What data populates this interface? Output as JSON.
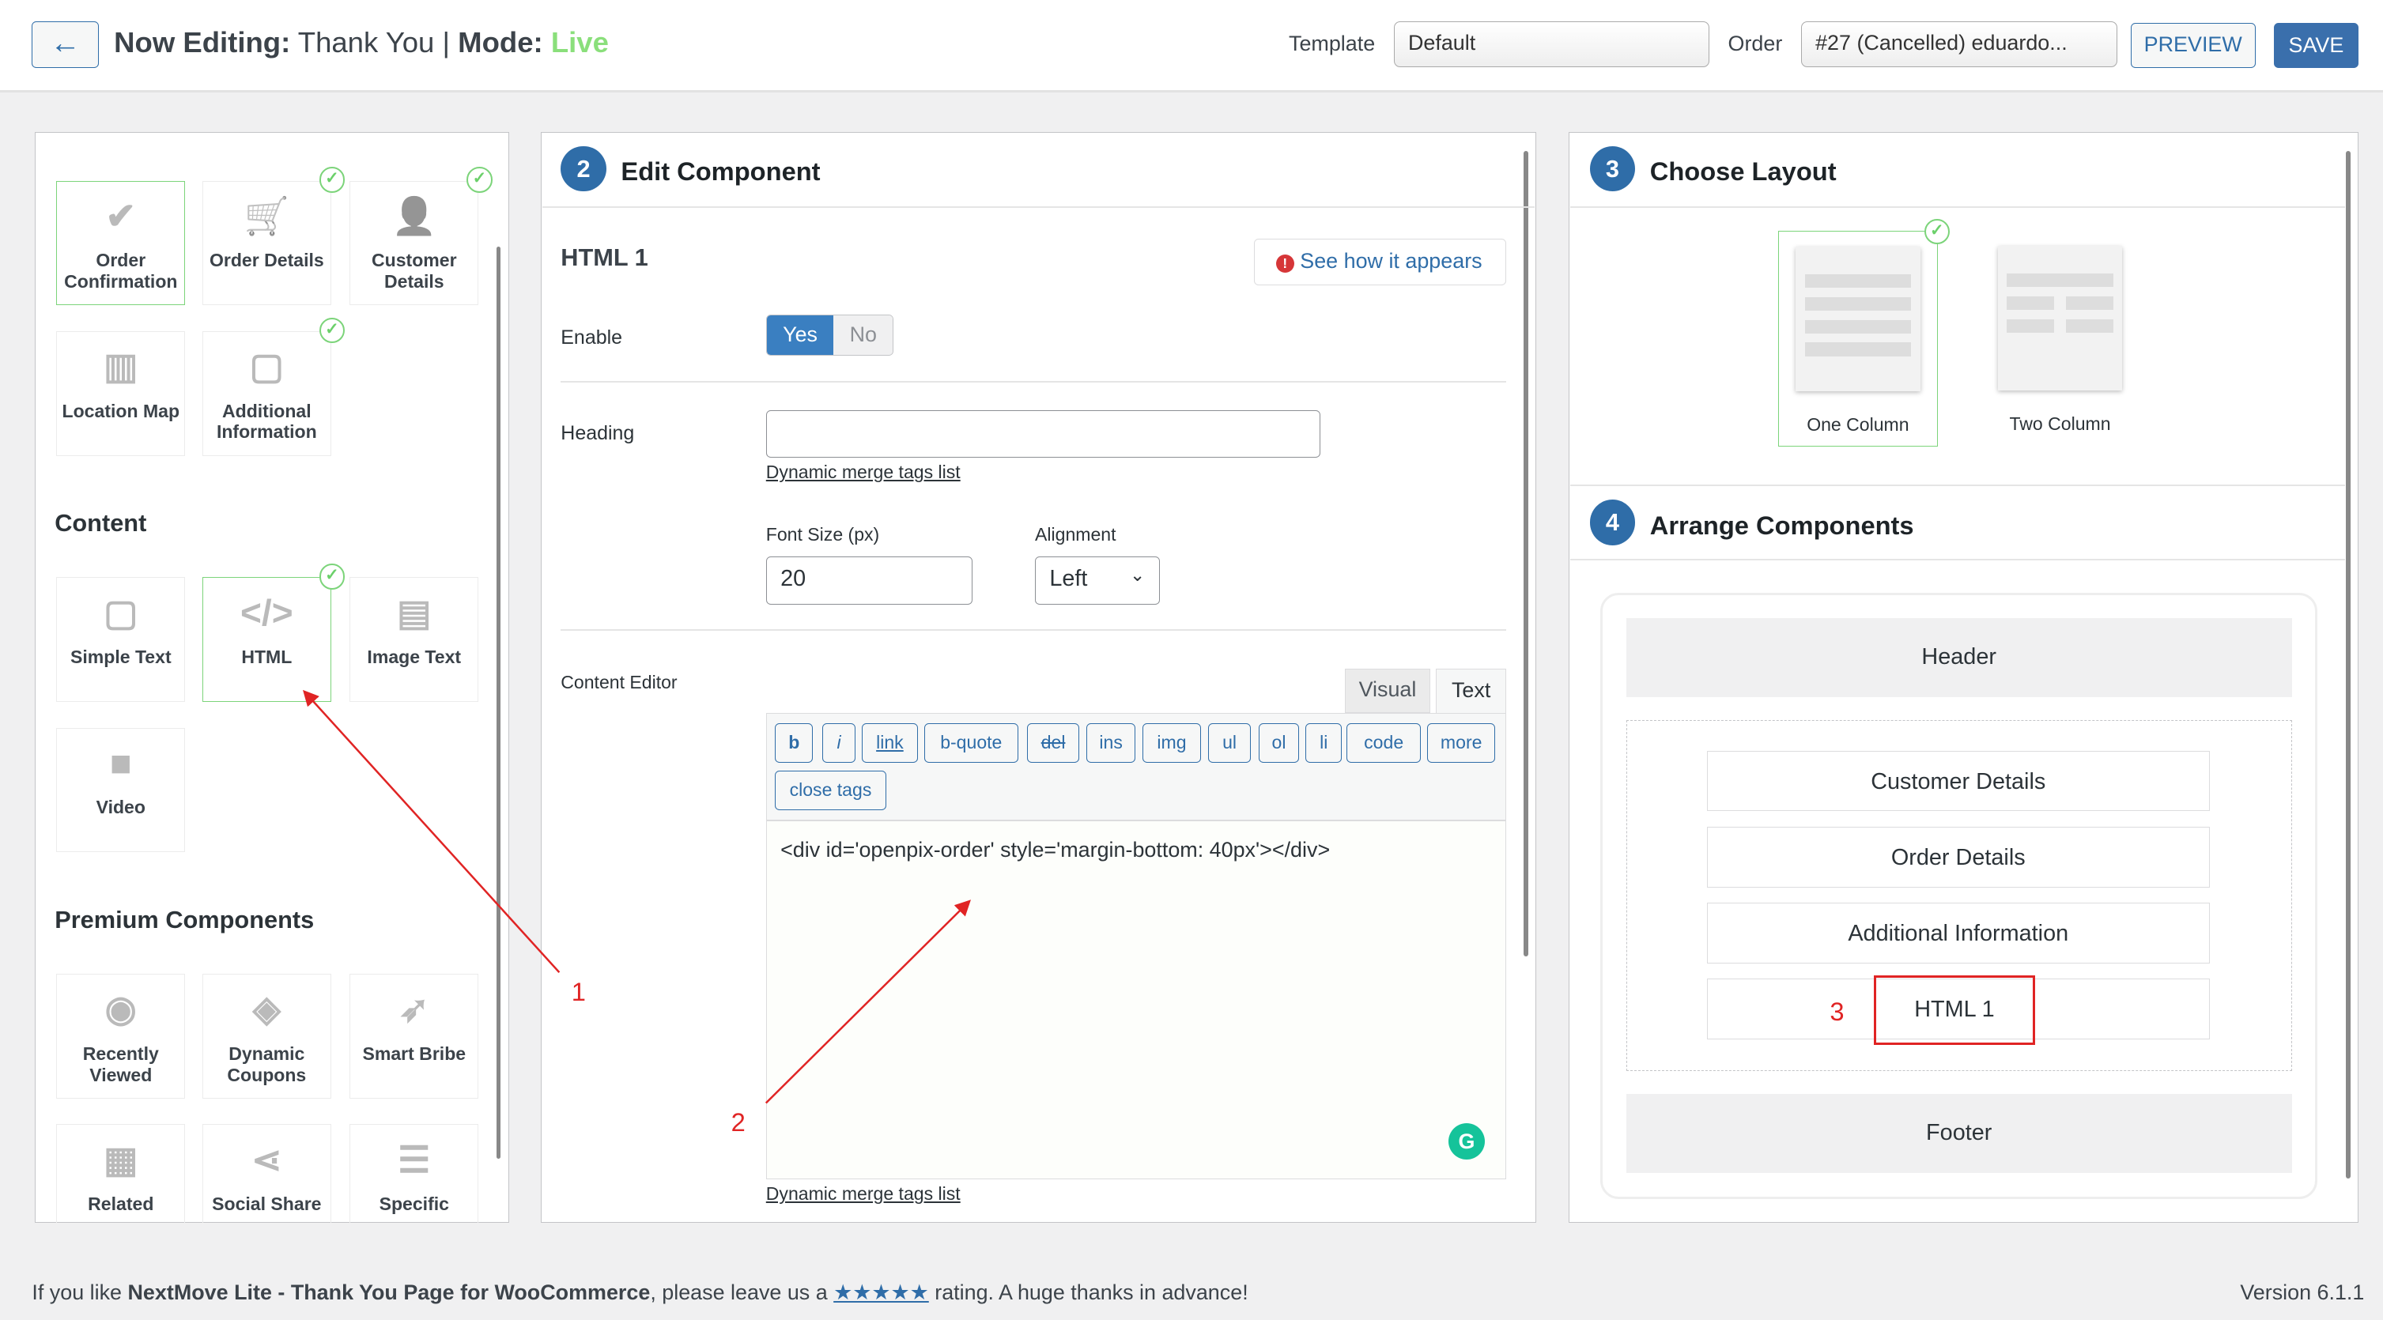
{
  "header": {
    "back_icon": "arrow-left-icon",
    "now_editing_label": "Now Editing:",
    "page_name": "Thank You",
    "separator": "|",
    "mode_label": "Mode:",
    "mode_value": "Live",
    "mode_color": "#8adf7b",
    "template_label": "Template",
    "template_value": "Default",
    "order_label": "Order",
    "order_value": "#27 (Cancelled) eduardo...",
    "preview_label": "PREVIEW",
    "save_label": "SAVE"
  },
  "components": {
    "basic": [
      {
        "label": "Order Confirmation",
        "icon": "check-circle-icon",
        "selected": true,
        "checked": false
      },
      {
        "label": "Order Details",
        "icon": "cart-icon",
        "checked": true
      },
      {
        "label": "Customer Details",
        "icon": "user-circle-icon",
        "checked": true
      },
      {
        "label": "Location Map",
        "icon": "map-icon",
        "checked": false
      },
      {
        "label": "Additional Information",
        "icon": "note-icon",
        "checked": true
      }
    ],
    "content_heading": "Content",
    "content": [
      {
        "label": "Simple Text",
        "icon": "note-icon"
      },
      {
        "label": "HTML",
        "icon": "code-icon",
        "selected": true,
        "checked": true
      },
      {
        "label": "Image Text",
        "icon": "id-card-icon"
      },
      {
        "label": "Video",
        "icon": "video-icon"
      }
    ],
    "premium_heading": "Premium Components",
    "premium": [
      {
        "label": "Recently Viewed",
        "icon": "eye-icon"
      },
      {
        "label": "Dynamic Coupons",
        "icon": "ticket-icon"
      },
      {
        "label": "Smart Bribe",
        "icon": "rocket-icon"
      },
      {
        "label": "Related",
        "icon": "grid-icon"
      },
      {
        "label": "Social Share",
        "icon": "share-icon"
      },
      {
        "label": "Specific",
        "icon": "list-icon"
      }
    ]
  },
  "edit": {
    "step": "2",
    "title": "Edit Component",
    "component_name": "HTML 1",
    "see_how": "See how it appears",
    "enable_label": "Enable",
    "yes": "Yes",
    "no": "No",
    "enabled": true,
    "heading_label": "Heading",
    "heading_value": "",
    "merge_tags": "Dynamic merge tags list",
    "font_size_label": "Font Size (px)",
    "font_size_value": "20",
    "alignment_label": "Alignment",
    "alignment_value": "Left",
    "content_editor_label": "Content Editor",
    "tab_visual": "Visual",
    "tab_text": "Text",
    "active_tab": "Text",
    "quicktags": [
      "b",
      "i",
      "link",
      "b-quote",
      "del",
      "ins",
      "img",
      "ul",
      "ol",
      "li",
      "code",
      "more"
    ],
    "close_tags": "close tags",
    "content": "<div id='openpix-order' style='margin-bottom: 40px'></div>",
    "merge_tags_bottom": "Dynamic merge tags list"
  },
  "layout": {
    "step": "3",
    "title": "Choose Layout",
    "options": [
      {
        "label": "One Column",
        "selected": true
      },
      {
        "label": "Two Column",
        "selected": false
      }
    ]
  },
  "arrange": {
    "step": "4",
    "title": "Arrange Components",
    "header": "Header",
    "items": [
      "Customer Details",
      "Order Details",
      "Additional Information",
      "HTML 1"
    ],
    "footer": "Footer"
  },
  "annotations": [
    "1",
    "2",
    "3"
  ],
  "footer": {
    "text_before": "If you like ",
    "product": "NextMove Lite - Thank You Page for WooCommerce",
    "text_mid": ", please leave us a ",
    "stars": "★★★★★",
    "text_after": " rating. A huge thanks in advance!",
    "version": "Version 6.1.1"
  }
}
